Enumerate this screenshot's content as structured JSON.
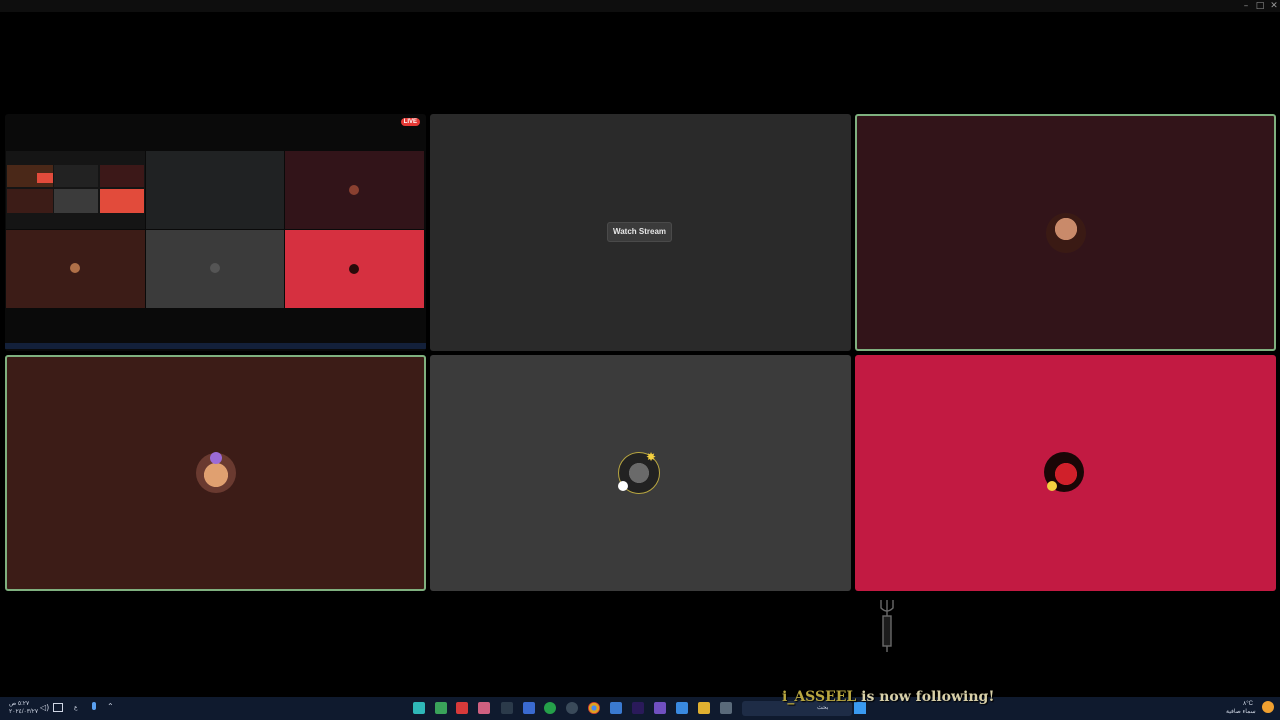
{
  "window": {
    "controls": {
      "minimize": "–",
      "maximize": "□",
      "close": "✕"
    }
  },
  "stream_tile": {
    "live_badge": "LIVE",
    "button_label": "Watch Stream"
  },
  "tiles": [
    {
      "id": "screenshare",
      "bg": "#0a0a0a",
      "speaking": false
    },
    {
      "id": "watch-stream",
      "bg": "#2a2a2a",
      "speaking": false
    },
    {
      "id": "participant-top-right",
      "bg": "#321419",
      "speaking": true
    },
    {
      "id": "participant-bottom-left",
      "bg": "#3c1c17",
      "speaking": true
    },
    {
      "id": "participant-bottom-middle",
      "bg": "#3b3b3b",
      "speaking": false
    },
    {
      "id": "participant-bottom-right",
      "bg": "#c21a42",
      "speaking": false
    }
  ],
  "notification": {
    "username": "i_ASSEEL",
    "message": "is now following!"
  },
  "taskbar": {
    "clock_time": "٥:٢٧ ص",
    "clock_date": "٢٠٢٤/٠٣/٢٧",
    "search_placeholder": "بحث",
    "weather_temp": "٨°C",
    "weather_desc": "سماء صافية",
    "lang": "ع"
  },
  "colors": {
    "speaking_border": "#7fb07f",
    "live_badge": "#e53935",
    "follow_username": "#b8a640"
  }
}
